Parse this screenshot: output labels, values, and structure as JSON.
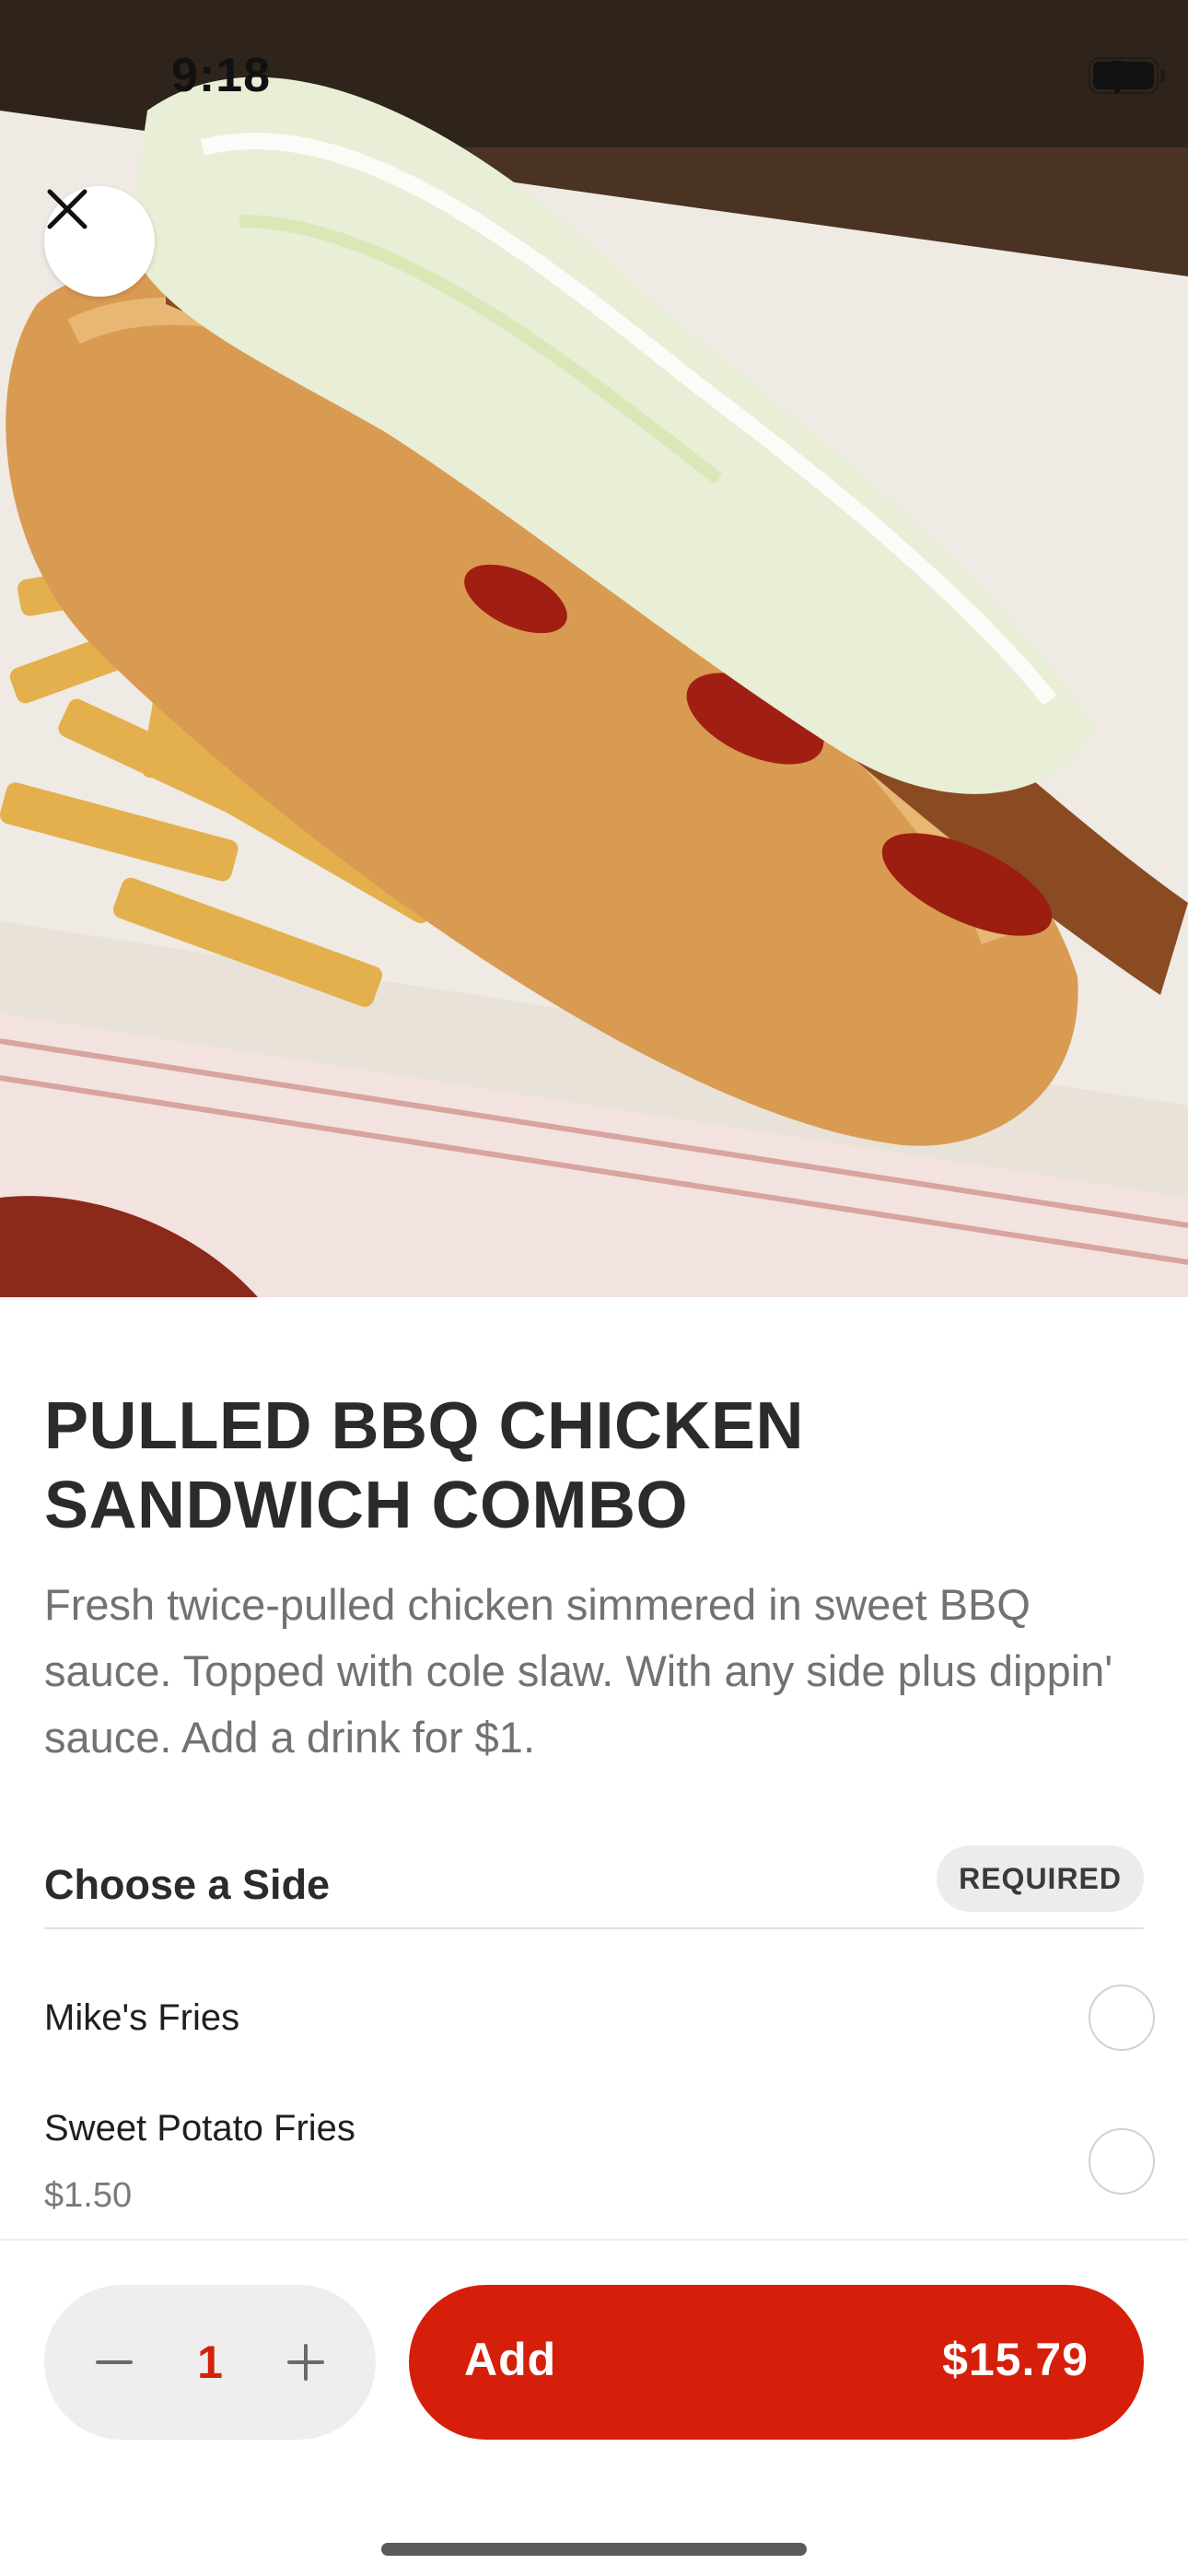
{
  "status_bar": {
    "time": "9:18"
  },
  "hero": {
    "image_icon": "food-photo-illustration"
  },
  "item": {
    "title": "PULLED BBQ CHICKEN SANDWICH COMBO",
    "description": "Fresh twice-pulled chicken simmered in sweet BBQ sauce. Topped with cole slaw. With any side plus dippin' sauce. Add a drink for $1."
  },
  "side_section": {
    "title": "Choose a Side",
    "badge": "REQUIRED",
    "options": [
      {
        "name": "Mike's Fries",
        "price": ""
      },
      {
        "name": "Sweet Potato Fries",
        "price": "$1.50"
      }
    ]
  },
  "quantity": {
    "value": "1"
  },
  "add_button": {
    "label": "Add",
    "price": "$15.79"
  },
  "colors": {
    "accent": "#d61f0a",
    "stepper_bg": "#eeeeee",
    "badge_bg": "#ececec"
  }
}
